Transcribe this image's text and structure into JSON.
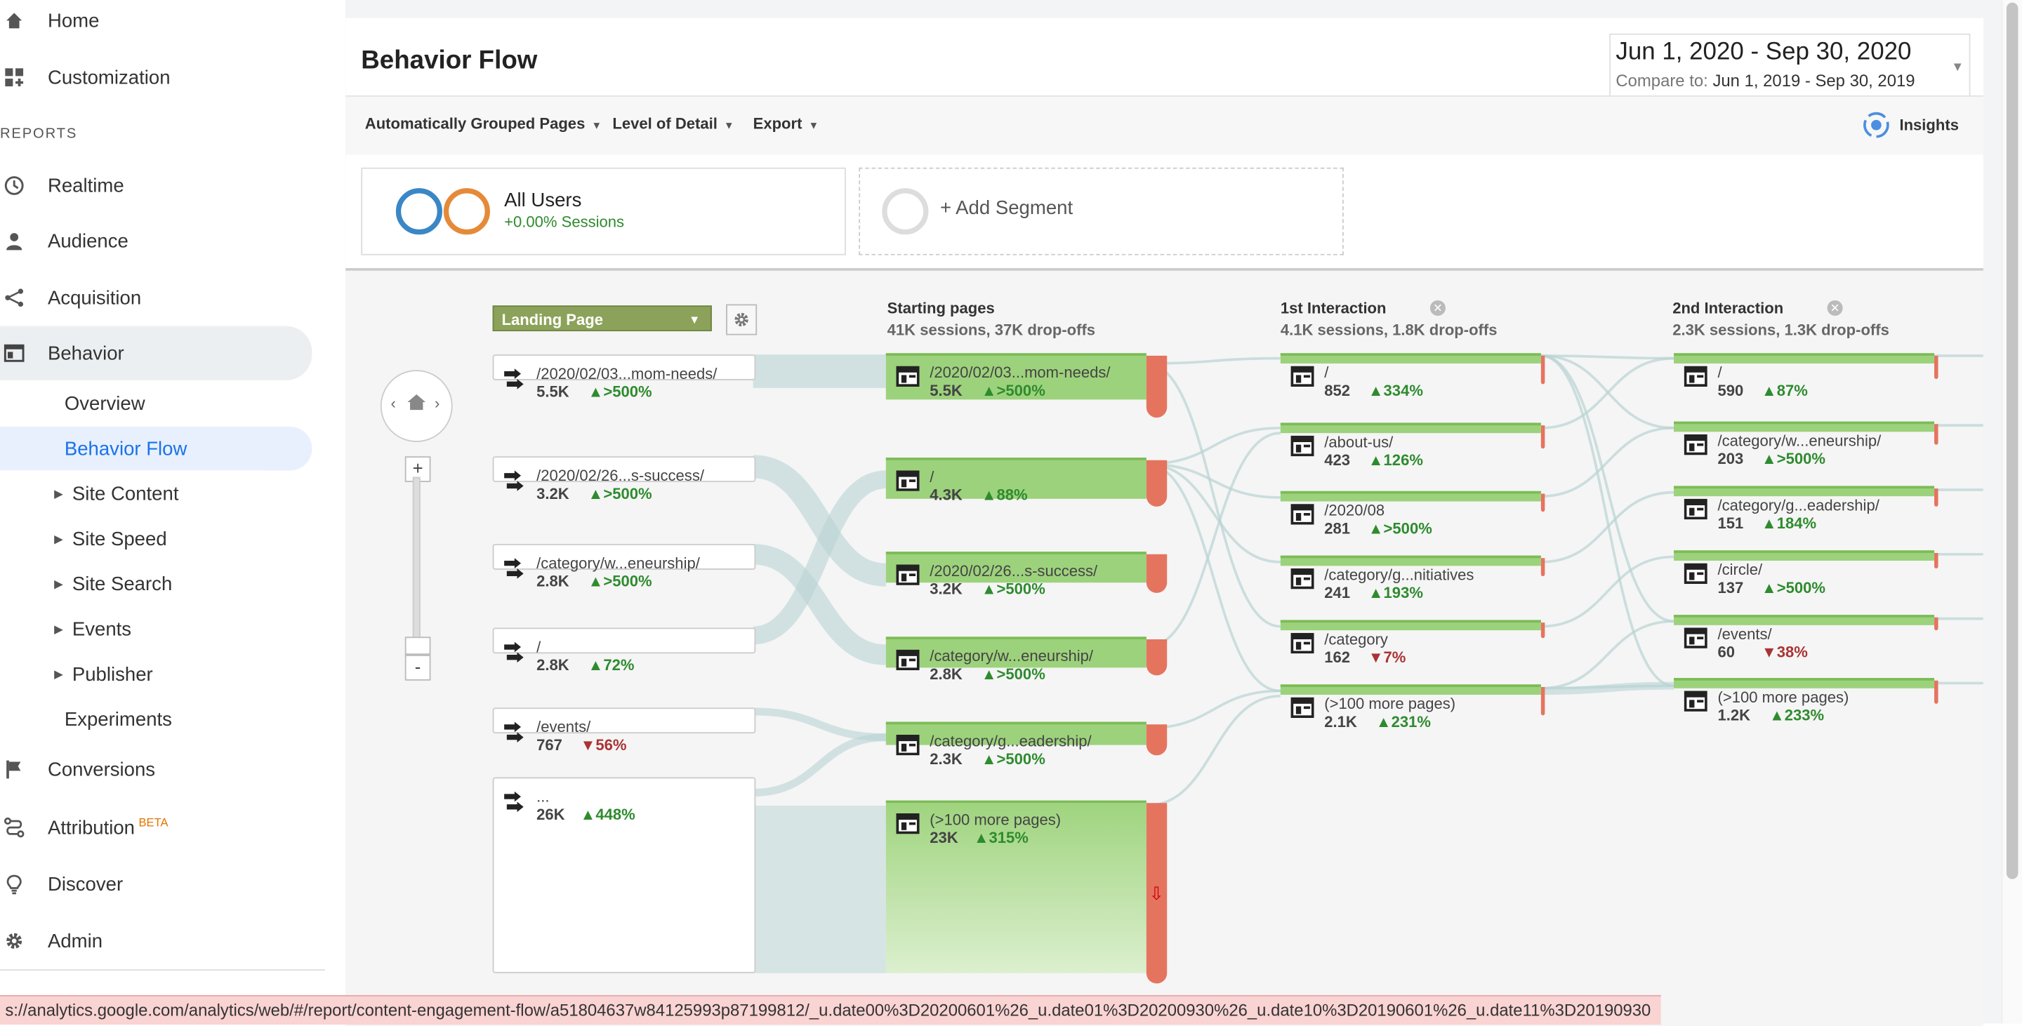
{
  "sidebar": {
    "items_top": [
      {
        "label": "Home",
        "icon": "home-icon"
      },
      {
        "label": "Customization",
        "icon": "dashboard-icon"
      }
    ],
    "section_label": "REPORTS",
    "reports": [
      {
        "label": "Realtime",
        "icon": "clock-icon"
      },
      {
        "label": "Audience",
        "icon": "person-icon"
      },
      {
        "label": "Acquisition",
        "icon": "acquisition-icon"
      },
      {
        "label": "Behavior",
        "icon": "behavior-icon"
      }
    ],
    "behavior_sub": [
      {
        "label": "Overview"
      },
      {
        "label": "Behavior Flow"
      },
      {
        "label": "Site Content"
      },
      {
        "label": "Site Speed"
      },
      {
        "label": "Site Search"
      },
      {
        "label": "Events"
      },
      {
        "label": "Publisher"
      },
      {
        "label": "Experiments"
      }
    ],
    "items_bottom": [
      {
        "label": "Conversions",
        "icon": "flag-icon"
      },
      {
        "label": "Attribution",
        "icon": "attribution-icon",
        "badge": "BETA"
      },
      {
        "label": "Discover",
        "icon": "lightbulb-icon"
      },
      {
        "label": "Admin",
        "icon": "gear-icon"
      }
    ]
  },
  "header": {
    "title": "Behavior Flow",
    "date_range": "Jun 1, 2020 - Sep 30, 2020",
    "compare_label": "Compare to:",
    "compare_range": "Jun 1, 2019 - Sep 30, 2019"
  },
  "toolbar": {
    "grouping": "Automatically Grouped Pages",
    "detail": "Level of Detail",
    "export": "Export",
    "insights": "Insights"
  },
  "segments": {
    "name": "All Users",
    "sub": "+0.00% Sessions",
    "add": "+ Add Segment"
  },
  "flow": {
    "dimension": "Landing Page",
    "columns": [
      {
        "title": "Starting pages",
        "sub": "41K sessions, 37K drop-offs"
      },
      {
        "title": "1st Interaction",
        "sub": "4.1K sessions, 1.8K drop-offs"
      },
      {
        "title": "2nd Interaction",
        "sub": "2.3K sessions, 1.3K drop-offs"
      }
    ],
    "landing": [
      {
        "name": "/2020/02/03...mom-needs/",
        "value": "5.5K",
        "change": "▲>500%"
      },
      {
        "name": "/2020/02/26...s-success/",
        "value": "3.2K",
        "change": "▲>500%"
      },
      {
        "name": "/category/w...eneurship/",
        "value": "2.8K",
        "change": "▲>500%"
      },
      {
        "name": "/",
        "value": "2.8K",
        "change": "▲72%"
      },
      {
        "name": "/events/",
        "value": "767",
        "change": "▼56%"
      },
      {
        "name": "...",
        "value": "26K",
        "change": "▲448%"
      }
    ],
    "starting": [
      {
        "name": "/2020/02/03...mom-needs/",
        "value": "5.5K",
        "change": "▲>500%"
      },
      {
        "name": "/",
        "value": "4.3K",
        "change": "▲88%"
      },
      {
        "name": "/2020/02/26...s-success/",
        "value": "3.2K",
        "change": "▲>500%"
      },
      {
        "name": "/category/w...eneurship/",
        "value": "2.8K",
        "change": "▲>500%"
      },
      {
        "name": "/category/g...eadership/",
        "value": "2.3K",
        "change": "▲>500%"
      },
      {
        "name": "(>100 more pages)",
        "value": "23K",
        "change": "▲315%"
      }
    ],
    "first": [
      {
        "name": "/",
        "value": "852",
        "change": "▲334%"
      },
      {
        "name": "/about-us/",
        "value": "423",
        "change": "▲126%"
      },
      {
        "name": "/2020/08",
        "value": "281",
        "change": "▲>500%"
      },
      {
        "name": "/category/g...nitiatives",
        "value": "241",
        "change": "▲193%"
      },
      {
        "name": "/category",
        "value": "162",
        "change": "▼7%"
      },
      {
        "name": "(>100 more pages)",
        "value": "2.1K",
        "change": "▲231%"
      }
    ],
    "second": [
      {
        "name": "/",
        "value": "590",
        "change": "▲87%"
      },
      {
        "name": "/category/w...eneurship/",
        "value": "203",
        "change": "▲>500%"
      },
      {
        "name": "/category/g...eadership/",
        "value": "151",
        "change": "▲184%"
      },
      {
        "name": "/circle/",
        "value": "137",
        "change": "▲>500%"
      },
      {
        "name": "/events/",
        "value": "60",
        "change": "▼38%"
      },
      {
        "name": "(>100 more pages)",
        "value": "1.2K",
        "change": "▲233%"
      }
    ]
  },
  "status_url": "s://analytics.google.com/analytics/web/#/report/content-engagement-flow/a51804637w84125993p87199812/_u.date00%3D20200601%26_u.date01%3D20200930%26_u.date10%3D20190601%26_u.date11%3D20190930",
  "colors": {
    "accent": "#1a73e8",
    "node_green": "#8fcf6a",
    "dropoff": "#e5745f",
    "up": "#2e8b2e",
    "down": "#a33333"
  }
}
